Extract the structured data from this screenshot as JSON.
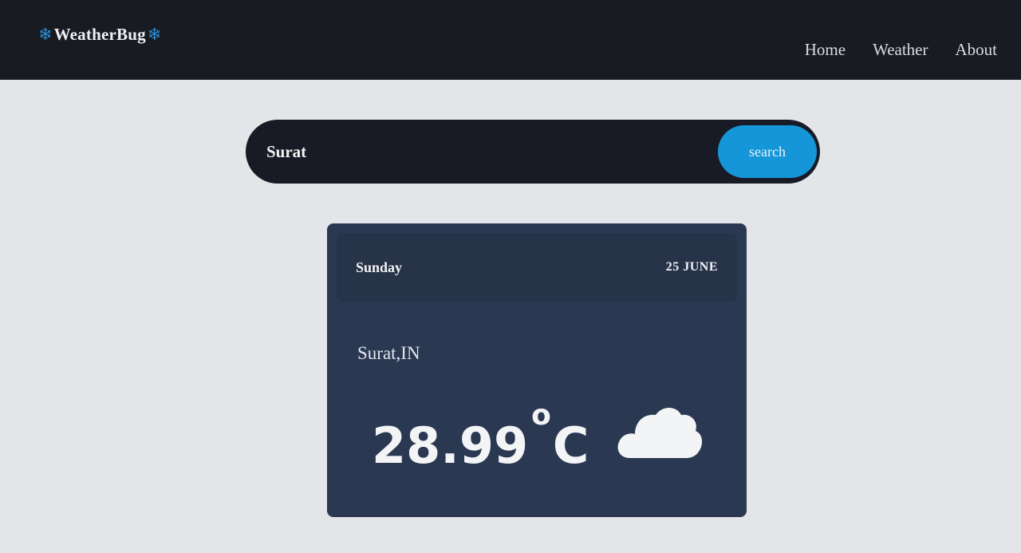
{
  "nav": {
    "brand": "WeatherBug",
    "brand_icon": "snowflake-icon",
    "links": [
      "Home",
      "Weather",
      "About"
    ]
  },
  "search": {
    "value": "Surat",
    "button_label": "search"
  },
  "card": {
    "day": "Sunday",
    "date": "25 JUNE",
    "city": "Surat,IN",
    "temperature": "28.99",
    "degree_symbol": "o",
    "unit": "C",
    "condition_icon": "cloud-icon"
  },
  "colors": {
    "navbar": "#181b22",
    "accent": "#1596d8",
    "card": "#2b3852"
  }
}
